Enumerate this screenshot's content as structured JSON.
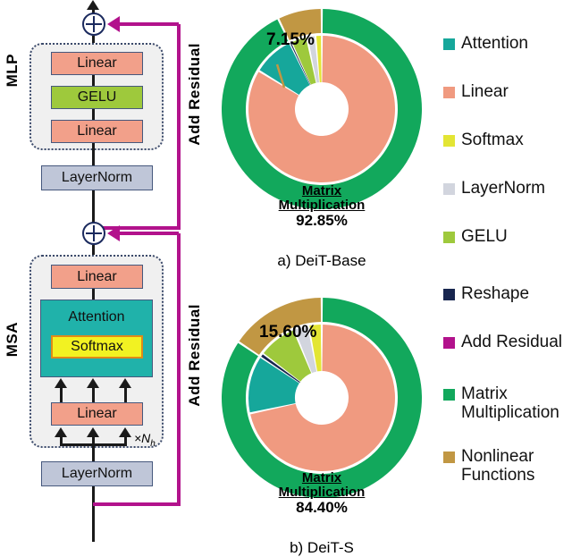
{
  "diagram": {
    "mlp_label": "MLP",
    "msa_label": "MSA",
    "add_residual_label_top": "Add Residual",
    "add_residual_label_bottom": "Add Residual",
    "heads_label": "×N",
    "heads_sub": "h",
    "mlp_nodes": [
      {
        "id": "mlp-linear-out",
        "label": "Linear",
        "type": "linear"
      },
      {
        "id": "mlp-gelu",
        "label": "GELU",
        "type": "gelu"
      },
      {
        "id": "mlp-linear-in",
        "label": "Linear",
        "type": "linear"
      }
    ],
    "mlp_layernorm": "LayerNorm",
    "msa_nodes": [
      {
        "id": "msa-linear-out",
        "label": "Linear",
        "type": "linear"
      },
      {
        "id": "msa-attention",
        "label": "Attention",
        "type": "attention"
      },
      {
        "id": "msa-softmax",
        "label": "Softmax",
        "type": "softmax"
      },
      {
        "id": "msa-linear-qkv",
        "label": "Linear",
        "type": "linear"
      }
    ],
    "msa_layernorm": "LayerNorm"
  },
  "charts": [
    {
      "id": "deit-base",
      "caption": "a)  DeiT-Base",
      "callout_outer": "7.15%",
      "center_label_line1": "Matrix",
      "center_label_line2": "Multiplication",
      "center_label_value": "92.85%"
    },
    {
      "id": "deit-s",
      "caption": "b)  DeiT-S",
      "callout_outer": "15.60%",
      "center_label_line1": "Matrix",
      "center_label_line2": "Multiplication",
      "center_label_value": "84.40%"
    }
  ],
  "legend": {
    "items": [
      {
        "label": "Attention",
        "color": "#16a79b"
      },
      {
        "label": "Linear",
        "color": "#f09a80"
      },
      {
        "label": "Softmax",
        "color": "#e3e534"
      },
      {
        "label": "LayerNorm",
        "color": "#d2d5de"
      },
      {
        "label": "GELU",
        "color": "#9ec93c"
      },
      {
        "label": "Reshape",
        "color": "#18264f"
      },
      {
        "label": "Add Residual",
        "color": "#b2128c"
      },
      {
        "label": "Matrix\nMultiplication",
        "color": "#12a85c"
      },
      {
        "label": "Nonlinear\nFunctions",
        "color": "#c19743"
      }
    ]
  },
  "chart_data": [
    {
      "type": "pie",
      "id": "deit-base",
      "title": "a)  DeiT-Base",
      "rings": [
        {
          "name": "outer",
          "categories": [
            "Matrix Multiplication",
            "Nonlinear Functions"
          ],
          "values": [
            92.85,
            7.15
          ],
          "colors": [
            "#12a85c",
            "#c19743"
          ],
          "labels": [
            "92.85%",
            "7.15%"
          ]
        },
        {
          "name": "inner",
          "categories": [
            "Linear",
            "Attention",
            "Reshape",
            "GELU",
            "LayerNorm",
            "Softmax"
          ],
          "values": [
            83.7,
            9.15,
            0.3,
            3.6,
            1.9,
            1.35
          ],
          "colors": [
            "#f09a80",
            "#16a79b",
            "#18264f",
            "#9ec93c",
            "#d2d5de",
            "#e3e534"
          ]
        }
      ],
      "legend_position": "right",
      "start_angle": 90,
      "direction": "counterclockwise"
    },
    {
      "type": "pie",
      "id": "deit-s",
      "title": "b)  DeiT-S",
      "rings": [
        {
          "name": "outer",
          "categories": [
            "Matrix Multiplication",
            "Nonlinear Functions"
          ],
          "values": [
            84.4,
            15.6
          ],
          "colors": [
            "#12a85c",
            "#c19743"
          ],
          "labels": [
            "84.40%",
            "15.60%"
          ]
        },
        {
          "name": "inner",
          "categories": [
            "Linear",
            "Attention",
            "Reshape",
            "GELU",
            "LayerNorm",
            "Softmax"
          ],
          "values": [
            71.6,
            12.8,
            0.8,
            8.6,
            3.3,
            2.9
          ],
          "colors": [
            "#f09a80",
            "#16a79b",
            "#18264f",
            "#9ec93c",
            "#d2d5de",
            "#e3e534"
          ]
        }
      ],
      "legend_position": "right",
      "start_angle": 90,
      "direction": "counterclockwise"
    }
  ]
}
